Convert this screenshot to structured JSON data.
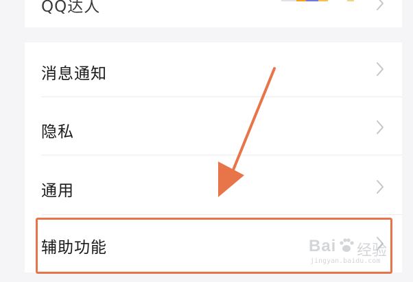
{
  "settings": {
    "rows": [
      {
        "label": "QQ达人"
      },
      {
        "label": "消息通知"
      },
      {
        "label": "隐私"
      },
      {
        "label": "通用"
      },
      {
        "label": "辅助功能"
      }
    ]
  },
  "annotation": {
    "highlight_color": "#e8744a",
    "arrow_color": "#e8744a",
    "highlighted_row": "辅助功能"
  },
  "watermark": {
    "brand": "Bai",
    "brand_suffix": "经验",
    "domain": "jingyan.baidu.com"
  },
  "icons": {
    "chevron": "chevron-right-icon",
    "watermark_paw": "paw-icon"
  },
  "colors": {
    "background": "#ffffff",
    "section_gap": "#f5f5f7",
    "divider": "#ececee",
    "text": "#1a1a1a",
    "chevron": "#c6c6c8"
  }
}
